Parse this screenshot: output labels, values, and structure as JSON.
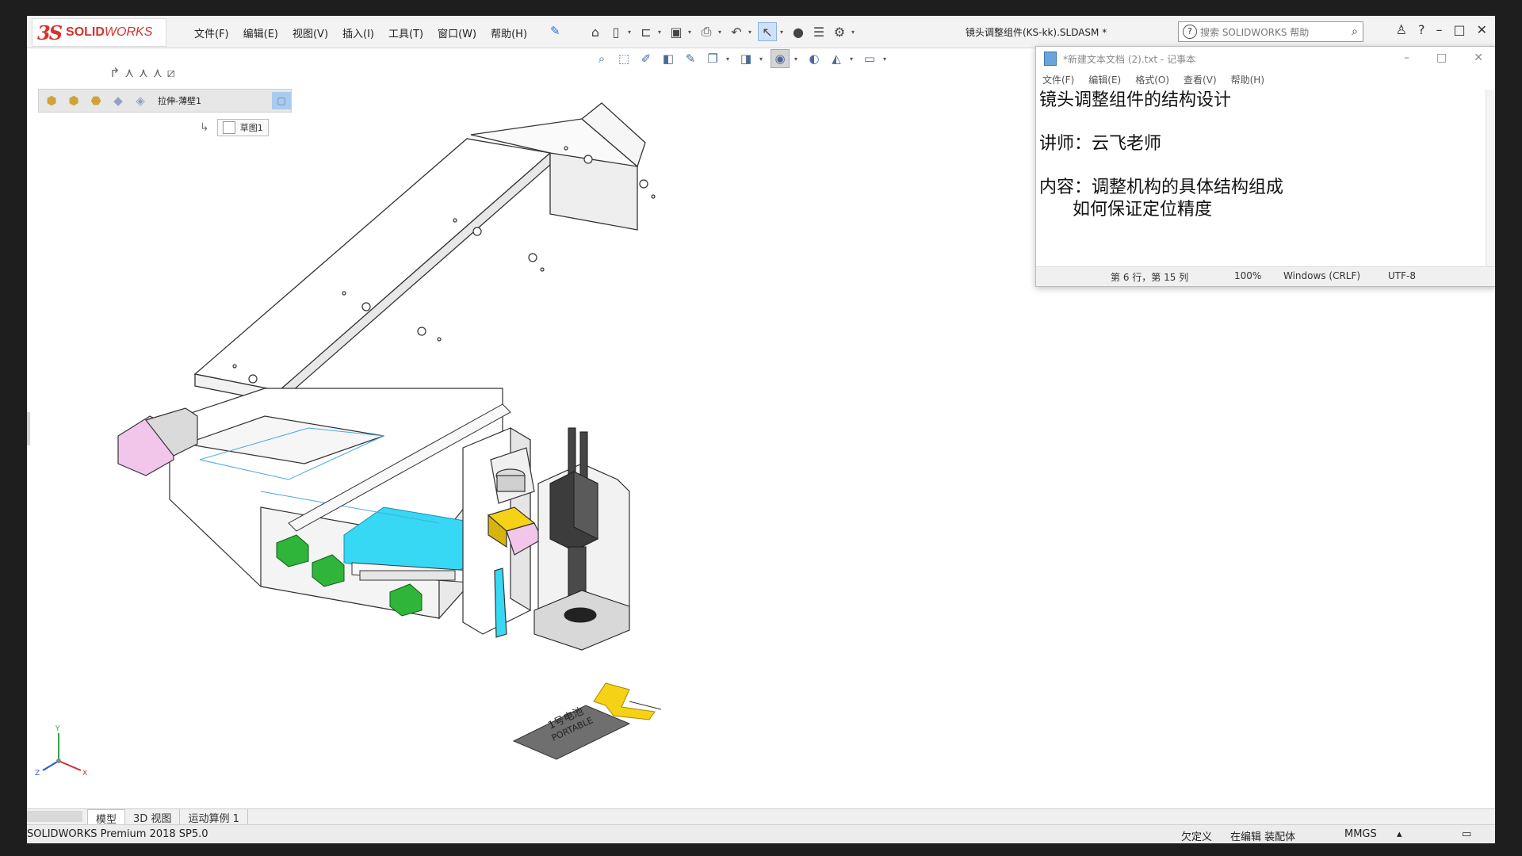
{
  "app": {
    "logo_mark": "3S",
    "logo_solid": "SOLID",
    "logo_works": "WORKS",
    "document_title": "镜头调整组件(KS-kk).SLDASM *"
  },
  "menu": [
    "文件(F)",
    "编辑(E)",
    "视图(V)",
    "插入(I)",
    "工具(T)",
    "窗口(W)",
    "帮助(H)"
  ],
  "search": {
    "placeholder": "搜索 SOLIDWORKS 帮助"
  },
  "feature_flyout": {
    "feature_label": "拉伸-薄壁1",
    "plane_label": "草图1"
  },
  "notepad": {
    "title": "*新建文本文档 (2).txt - 记事本",
    "menu": [
      "文件(F)",
      "编辑(E)",
      "格式(O)",
      "查看(V)",
      "帮助(H)"
    ],
    "lines": [
      "镜头调整组件的结构设计",
      "",
      "讲师：云飞老师",
      "",
      "内容：调整机构的具体结构组成",
      "      如何保证定位精度"
    ],
    "status": {
      "position": "第 6 行，第 15 列",
      "zoom": "100%",
      "line_ending": "Windows (CRLF)",
      "encoding": "UTF-8"
    }
  },
  "bottom_tabs": [
    "模型",
    "3D 视图",
    "运动算例 1"
  ],
  "statusbar": {
    "product": "SOLIDWORKS Premium 2018 SP5.0",
    "state1": "欠定义",
    "state2": "在编辑 装配体",
    "units": "MMGS"
  },
  "part_label": {
    "line1": "1号电池",
    "line2": "PORTABLE"
  },
  "colors": {
    "accent": "#d7322b",
    "highlight_cyan": "#37d8f3",
    "green_clamp": "#2fb53a",
    "pink_motor": "#f2c6ea",
    "yellow_part": "#f5d215"
  },
  "triad": {
    "x": "X",
    "y": "Y",
    "z": "Z"
  }
}
